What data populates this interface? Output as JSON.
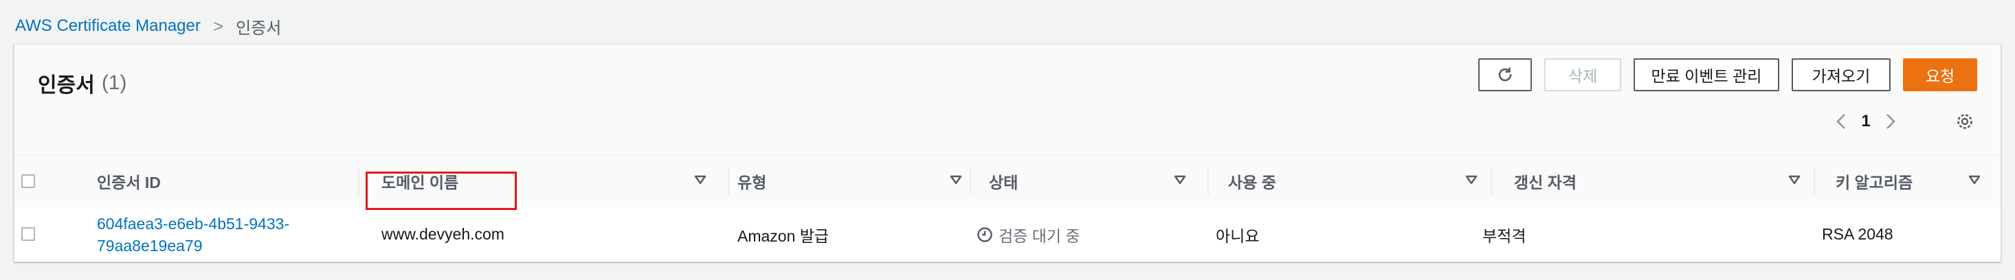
{
  "breadcrumb": {
    "items": [
      {
        "label": "AWS Certificate Manager",
        "link": true
      },
      {
        "label": "인증서",
        "link": false
      }
    ],
    "separator": ">"
  },
  "panel": {
    "title": "인증서",
    "count": "(1)"
  },
  "toolbar": {
    "refresh_icon": "refresh-icon",
    "delete_label": "삭제",
    "expire_events_label": "만료 이벤트 관리",
    "import_label": "가져오기",
    "request_label": "요청"
  },
  "pagination": {
    "current_page": "1"
  },
  "table": {
    "columns": [
      "인증서 ID",
      "도메인 이름",
      "유형",
      "상태",
      "사용 중",
      "갱신 자격",
      "키 알고리즘"
    ],
    "rows": [
      {
        "cert_id_line1": "604faea3-e6eb-4b51-9433-",
        "cert_id_line2": "79aa8e19ea79",
        "domain": "www.devyeh.com",
        "type": "Amazon 발급",
        "status": "검증 대기 중",
        "in_use": "아니요",
        "renewal": "부적격",
        "key_algorithm": "RSA 2048"
      }
    ]
  },
  "colors": {
    "primary_button": "#ec7211",
    "link": "#0073bb",
    "highlight_box": "#e0191d"
  }
}
